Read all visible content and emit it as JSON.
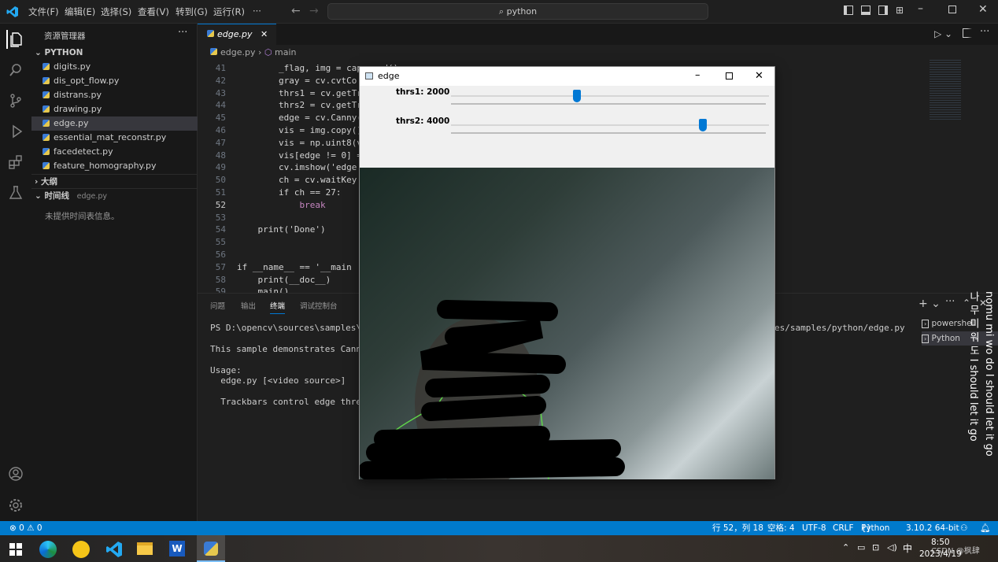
{
  "menu": [
    "文件(F)",
    "编辑(E)",
    "选择(S)",
    "查看(V)",
    "转到(G)",
    "运行(R)",
    "···"
  ],
  "search": "python",
  "sidebar": {
    "title": "资源管理器",
    "folder": "PYTHON",
    "files": [
      "digits.py",
      "dis_opt_flow.py",
      "distrans.py",
      "drawing.py",
      "edge.py",
      "essential_mat_reconstr.py",
      "facedetect.py",
      "feature_homography.py"
    ],
    "outline": "大纲",
    "timeline": "时间线",
    "timeline_file": "edge.py",
    "timeline_empty": "未提供时间表信息。"
  },
  "editor": {
    "tab": "edge.py",
    "breadcrumb_file": "edge.py",
    "breadcrumb_symbol": "main",
    "lines": [
      {
        "n": "41",
        "code": "        _flag, img = cap.read()"
      },
      {
        "n": "42",
        "code": "        gray = cv.cvtCo"
      },
      {
        "n": "43",
        "code": "        thrs1 = cv.getTr"
      },
      {
        "n": "44",
        "code": "        thrs2 = cv.getTr"
      },
      {
        "n": "45",
        "code": "        edge = cv.Canny("
      },
      {
        "n": "46",
        "code": "        vis = img.copy()"
      },
      {
        "n": "47",
        "code": "        vis = np.uint8(v"
      },
      {
        "n": "48",
        "code": "        vis[edge != 0] ="
      },
      {
        "n": "49",
        "code": "        cv.imshow('edge"
      },
      {
        "n": "50",
        "code": "        ch = cv.waitKey"
      },
      {
        "n": "51",
        "code": "        if ch == 27:"
      },
      {
        "n": "52",
        "code": "            break"
      },
      {
        "n": "53",
        "code": ""
      },
      {
        "n": "54",
        "code": "    print('Done')"
      },
      {
        "n": "55",
        "code": ""
      },
      {
        "n": "56",
        "code": ""
      },
      {
        "n": "57",
        "code": "if __name__ == '__main"
      },
      {
        "n": "58",
        "code": "    print(__doc__)"
      },
      {
        "n": "59",
        "code": "    main()"
      }
    ]
  },
  "panel": {
    "tabs": [
      "问题",
      "输出",
      "终端",
      "调试控制台"
    ],
    "active_tab": "终端",
    "terminal": [
      "PS D:\\opencv\\sources\\samples\\pyt",
      "",
      "This sample demonstrates Canny e",
      "",
      "Usage:",
      "  edge.py [<video source>]",
      "",
      "  Trackbars control edge thresho"
    ],
    "terminal_right": "es/samples/python/edge.py",
    "shells": [
      "powershell",
      "Python"
    ]
  },
  "cv_window": {
    "title": "edge",
    "trackbars": [
      {
        "label": "thrs1: 2000",
        "value": 2000,
        "max": 5000
      },
      {
        "label": "thrs2: 4000",
        "value": 4000,
        "max": 5000
      }
    ]
  },
  "status": {
    "errors": "⊗ 0 ⚠ 0",
    "position": "行 52，列 18",
    "spaces": "空格: 4",
    "encoding": "UTF-8",
    "eol": "CRLF",
    "language": "Python",
    "interpreter": "3.10.2 64-bit"
  },
  "taskbar": {
    "time": "8:50",
    "date": "2023/4/19",
    "ime": "中",
    "watermark": "CSDN @枫肆"
  },
  "overlay_text": "nomu mi wo do I should let it go 나 무 미 워 도 I should let it go"
}
